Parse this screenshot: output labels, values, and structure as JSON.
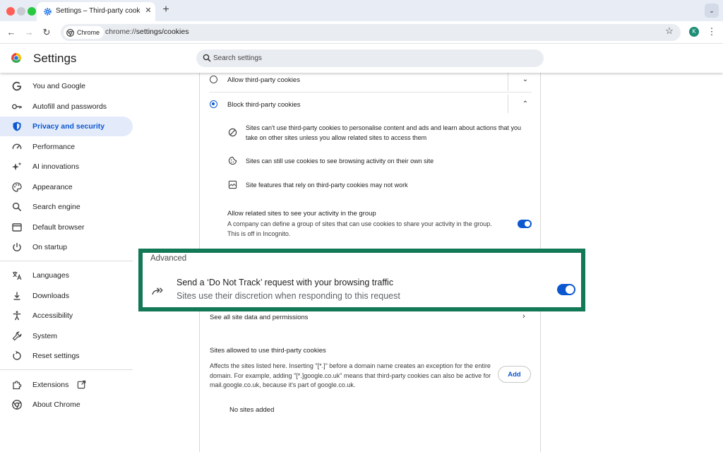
{
  "browser": {
    "tab_title": "Settings – Third-party cookies",
    "tab_close": "✕",
    "new_tab": "+",
    "tab_search": "⌄",
    "back": "←",
    "forward": "→",
    "reload": "↻",
    "chip_label": "Chrome",
    "url_prefix": "chrome://",
    "url_path": "settings/cookies",
    "bookmark": "☆",
    "profile_initial": "K",
    "menu": "⋮"
  },
  "header": {
    "title": "Settings",
    "search_placeholder": "Search settings"
  },
  "sidebar": {
    "items": [
      {
        "label": "You and Google",
        "icon": "google-icon"
      },
      {
        "label": "Autofill and passwords",
        "icon": "key-icon"
      },
      {
        "label": "Privacy and security",
        "icon": "shield-icon",
        "active": true
      },
      {
        "label": "Performance",
        "icon": "speedometer-icon"
      },
      {
        "label": "AI innovations",
        "icon": "sparkle-icon"
      },
      {
        "label": "Appearance",
        "icon": "palette-icon"
      },
      {
        "label": "Search engine",
        "icon": "search-icon"
      },
      {
        "label": "Default browser",
        "icon": "browser-window-icon"
      },
      {
        "label": "On startup",
        "icon": "power-icon"
      },
      {
        "label": "Languages",
        "icon": "translate-icon"
      },
      {
        "label": "Downloads",
        "icon": "download-icon"
      },
      {
        "label": "Accessibility",
        "icon": "accessibility-icon"
      },
      {
        "label": "System",
        "icon": "wrench-icon"
      },
      {
        "label": "Reset settings",
        "icon": "reset-icon"
      },
      {
        "label": "Extensions",
        "icon": "puzzle-icon"
      },
      {
        "label": "About Chrome",
        "icon": "chrome-icon"
      }
    ]
  },
  "cookies": {
    "allow_label": "Allow third-party cookies",
    "block_label": "Block third-party cookies",
    "selected": "block",
    "bullets": [
      "Sites can't use third-party cookies to personalise content and ads and learn about actions that you take on other sites unless you allow related sites to access them",
      "Sites can still use cookies to see browsing activity on their own site",
      "Site features that rely on third-party cookies may not work"
    ],
    "related_title": "Allow related sites to see your activity in the group",
    "related_desc": "A company can define a group of sites that can use cookies to share your activity in the group. This is off in Incognito.",
    "related_enabled": true
  },
  "advanced": {
    "heading": "Advanced",
    "dnt_title": "Send a ‘Do Not Track’ request with your browsing traffic",
    "dnt_subtitle": "Sites use their discretion when responding to this request",
    "dnt_enabled": true,
    "highlight_color": "#127856"
  },
  "site_data": {
    "see_all_label": "See all site data and permissions",
    "allowed_title": "Sites allowed to use third-party cookies",
    "allowed_desc": "Affects the sites listed here. Inserting \"[*.]\" before a domain name creates an exception for the entire domain. For example, adding \"[*.]google.co.uk\" means that third-party cookies can also be active for mail.google.co.uk, because it's part of google.co.uk.",
    "add_label": "Add",
    "empty_label": "No sites added"
  },
  "colors": {
    "accent": "#0b57d0",
    "active_bg": "#e3ebfb"
  }
}
